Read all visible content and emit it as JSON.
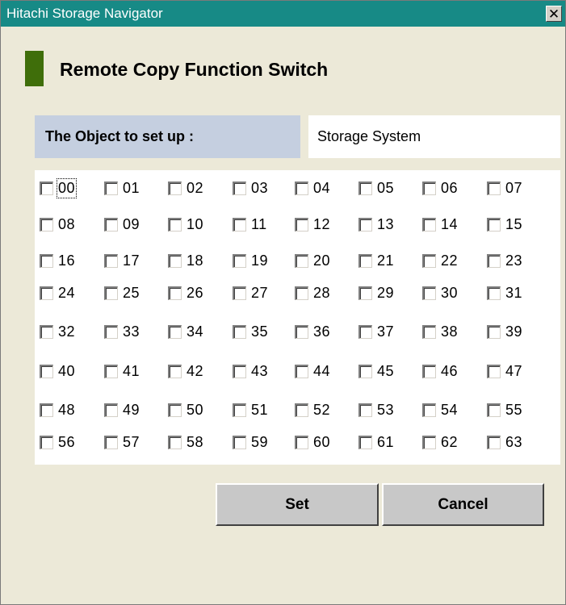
{
  "window": {
    "title": "Hitachi Storage Navigator",
    "close_glyph": "✕"
  },
  "heading": {
    "title": "Remote Copy Function Switch"
  },
  "object": {
    "label": "The Object to set up :",
    "value": "Storage System"
  },
  "switches": [
    "00",
    "01",
    "02",
    "03",
    "04",
    "05",
    "06",
    "07",
    "08",
    "09",
    "10",
    "11",
    "12",
    "13",
    "14",
    "15",
    "16",
    "17",
    "18",
    "19",
    "20",
    "21",
    "22",
    "23",
    "24",
    "25",
    "26",
    "27",
    "28",
    "29",
    "30",
    "31",
    "32",
    "33",
    "34",
    "35",
    "36",
    "37",
    "38",
    "39",
    "40",
    "41",
    "42",
    "43",
    "44",
    "45",
    "46",
    "47",
    "48",
    "49",
    "50",
    "51",
    "52",
    "53",
    "54",
    "55",
    "56",
    "57",
    "58",
    "59",
    "60",
    "61",
    "62",
    "63"
  ],
  "buttons": {
    "set": "Set",
    "cancel": "Cancel"
  },
  "colors": {
    "titlebar": "#178a86",
    "marker": "#3f6e0a",
    "label_bg": "#c5cfe0"
  }
}
